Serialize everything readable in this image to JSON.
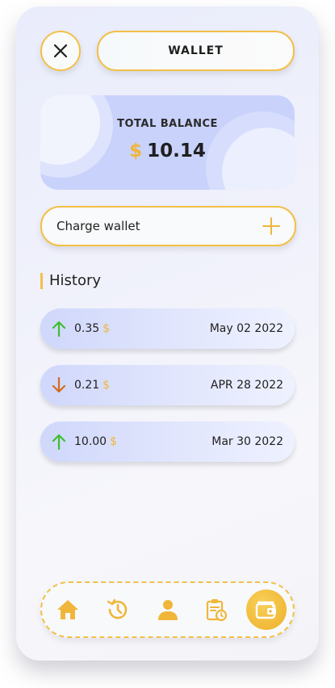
{
  "header": {
    "close_icon": "close-icon",
    "title": "WALLET"
  },
  "balance": {
    "label": "TOTAL BALANCE",
    "currency": "$",
    "amount": "10.14"
  },
  "charge": {
    "label": "Charge wallet",
    "icon": "plus-icon"
  },
  "history": {
    "title": "History",
    "items": [
      {
        "direction": "up",
        "amount": "0.35",
        "currency": "$",
        "date": "May 02 2022"
      },
      {
        "direction": "down",
        "amount": "0.21",
        "currency": "$",
        "date": "APR 28 2022"
      },
      {
        "direction": "up",
        "amount": "10.00",
        "currency": "$",
        "date": "Mar 30 2022"
      }
    ]
  },
  "nav": {
    "items": [
      "home-icon",
      "history-icon",
      "profile-icon",
      "clipboard-clock-icon",
      "wallet-icon"
    ],
    "active": "wallet-icon"
  },
  "colors": {
    "accent": "#f3c047",
    "up": "#3dbf2e",
    "down": "#d76a1e"
  }
}
